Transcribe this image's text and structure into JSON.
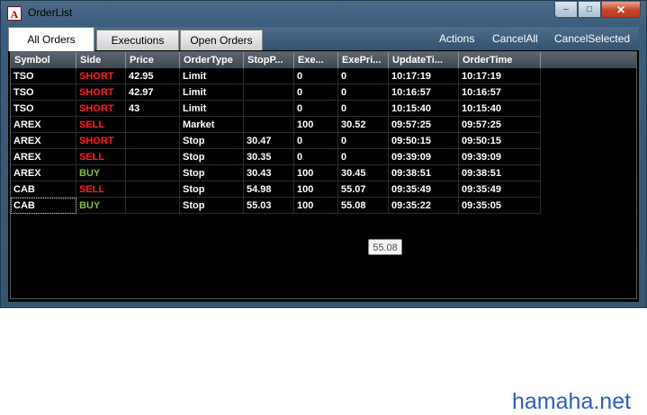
{
  "window": {
    "title": "OrderList",
    "app_icon_glyph": "A",
    "controls": [
      "minimize-icon",
      "maximize-icon",
      "close-icon"
    ]
  },
  "tabs": [
    {
      "label": "All Orders",
      "active": true
    },
    {
      "label": "Executions",
      "active": false
    },
    {
      "label": "Open Orders",
      "active": false
    }
  ],
  "actions": {
    "actions": "Actions",
    "cancel_all": "CancelAll",
    "cancel_selected": "CancelSelected"
  },
  "columns": [
    "Symbol",
    "Side",
    "Price",
    "OrderType",
    "StopP...",
    "Exe...",
    "ExePri...",
    "UpdateTi...",
    "OrderTime"
  ],
  "side_colors": {
    "SHORT": "#ff2020",
    "SELL": "#ff2020",
    "BUY": "#7fc13a"
  },
  "rows": [
    [
      "TSO",
      "SHORT",
      "42.95",
      "Limit",
      "",
      "0",
      "0",
      "10:17:19",
      "10:17:19"
    ],
    [
      "TSO",
      "SHORT",
      "42.97",
      "Limit",
      "",
      "0",
      "0",
      "10:16:57",
      "10:16:57"
    ],
    [
      "TSO",
      "SHORT",
      "43",
      "Limit",
      "",
      "0",
      "0",
      "10:15:40",
      "10:15:40"
    ],
    [
      "AREX",
      "SELL",
      "",
      "Market",
      "",
      "100",
      "30.52",
      "09:57:25",
      "09:57:25"
    ],
    [
      "AREX",
      "SHORT",
      "",
      "Stop",
      "30.47",
      "0",
      "0",
      "09:50:15",
      "09:50:15"
    ],
    [
      "AREX",
      "SELL",
      "",
      "Stop",
      "30.35",
      "0",
      "0",
      "09:39:09",
      "09:39:09"
    ],
    [
      "AREX",
      "BUY",
      "",
      "Stop",
      "30.43",
      "100",
      "30.45",
      "09:38:51",
      "09:38:51"
    ],
    [
      "CAB",
      "SELL",
      "",
      "Stop",
      "54.98",
      "100",
      "55.07",
      "09:35:49",
      "09:35:49"
    ],
    [
      "CAB",
      "BUY",
      "",
      "Stop",
      "55.03",
      "100",
      "55.08",
      "09:35:22",
      "09:35:05"
    ]
  ],
  "tooltip": "55.08",
  "watermark": "hamaha.net"
}
